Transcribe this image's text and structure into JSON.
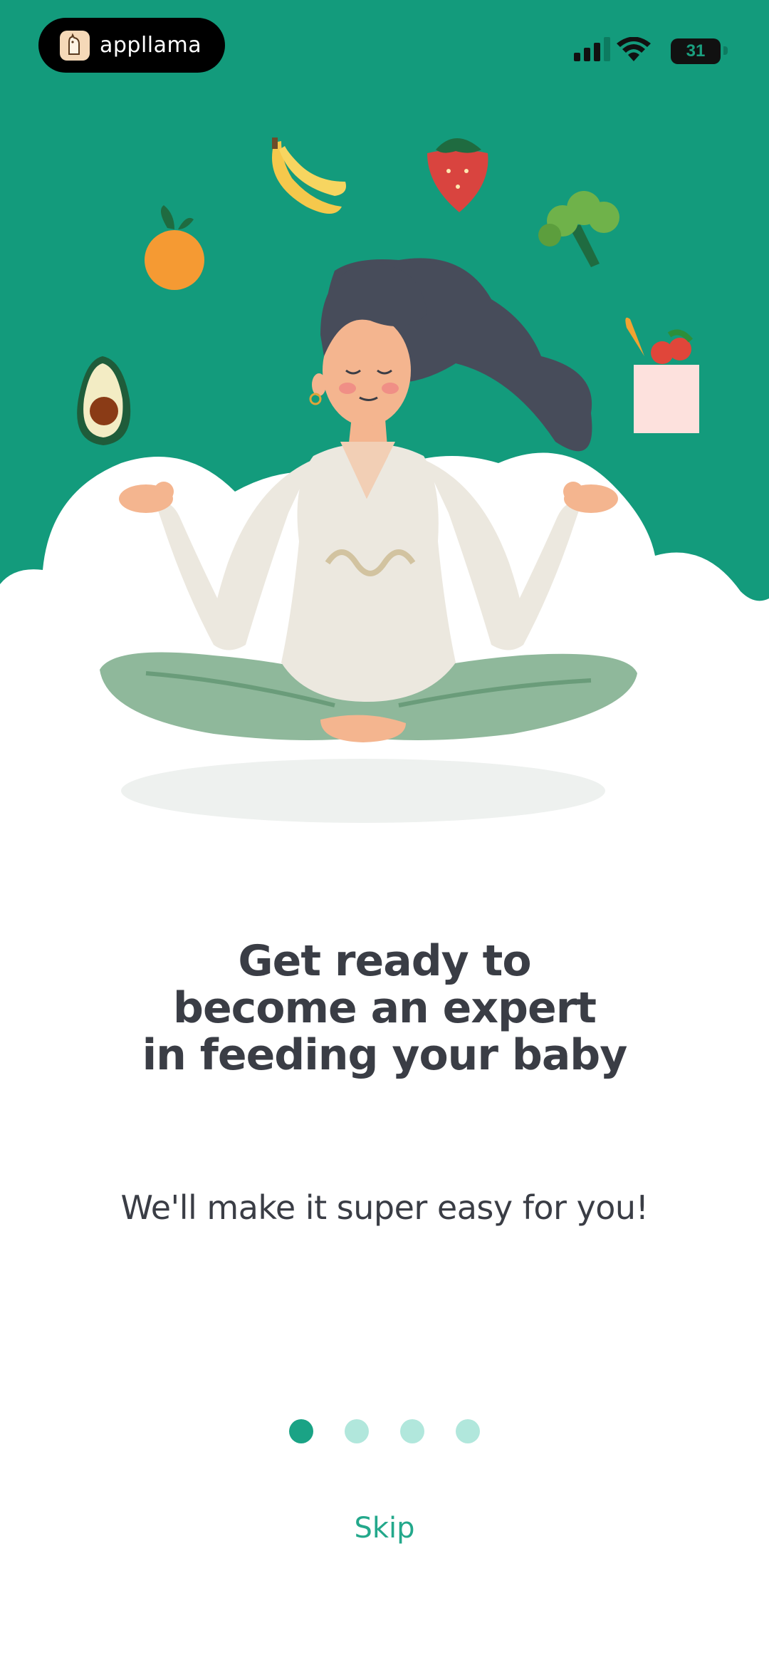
{
  "status_bar": {
    "app_badge_label": "appllama",
    "battery_level": "31"
  },
  "colors": {
    "hero_background": "#139b7c",
    "accent": "#1aa385",
    "dot_inactive": "#b1e7dc",
    "text_dark": "#3a3d45"
  },
  "onboarding": {
    "headline_lines": [
      "Get ready to",
      "become an expert",
      "in feeding your baby"
    ],
    "subtitle": "We'll make it super easy for you!",
    "page_indicator": {
      "total": 4,
      "current": 1
    },
    "skip_label": "Skip"
  }
}
